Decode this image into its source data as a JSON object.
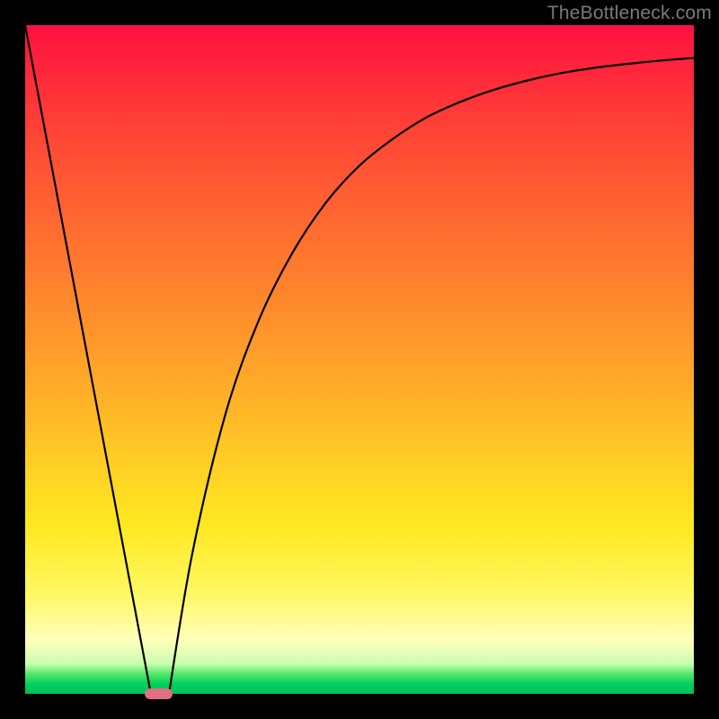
{
  "watermark": {
    "text": "TheBottleneck.com"
  },
  "chart_data": {
    "type": "line",
    "title": "",
    "xlabel": "",
    "ylabel": "",
    "xlim": [
      0,
      1
    ],
    "ylim": [
      0,
      1
    ],
    "grid": false,
    "legend": false,
    "background_gradient": {
      "orientation": "vertical",
      "stops": [
        {
          "pos": 0.0,
          "color": "#ff1040"
        },
        {
          "pos": 0.3,
          "color": "#ff6a30"
        },
        {
          "pos": 0.6,
          "color": "#ffc024"
        },
        {
          "pos": 0.85,
          "color": "#fff862"
        },
        {
          "pos": 0.96,
          "color": "#c8ffb0"
        },
        {
          "pos": 1.0,
          "color": "#00c055"
        }
      ]
    },
    "series": [
      {
        "name": "left-line",
        "description": "straight line descending from top-left toward bottom valley",
        "x": [
          0.0,
          0.188
        ],
        "y": [
          1.0,
          0.0
        ]
      },
      {
        "name": "right-curve",
        "description": "rising concave curve from the valley toward upper-right, flattening out",
        "x": [
          0.215,
          0.25,
          0.3,
          0.35,
          0.4,
          0.45,
          0.5,
          0.55,
          0.6,
          0.65,
          0.7,
          0.75,
          0.8,
          0.85,
          0.9,
          0.95,
          1.0
        ],
        "y": [
          0.0,
          0.21,
          0.42,
          0.56,
          0.66,
          0.735,
          0.79,
          0.83,
          0.862,
          0.885,
          0.903,
          0.917,
          0.928,
          0.936,
          0.942,
          0.947,
          0.951
        ]
      }
    ],
    "marker": {
      "shape": "pill",
      "x": 0.2,
      "y": 0.0,
      "color": "#e07080",
      "width_frac": 0.042,
      "height_frac": 0.016
    }
  },
  "colors": {
    "frame": "#000000",
    "curve": "#000000",
    "marker": "#e07080",
    "watermark": "#7a7a7a"
  }
}
